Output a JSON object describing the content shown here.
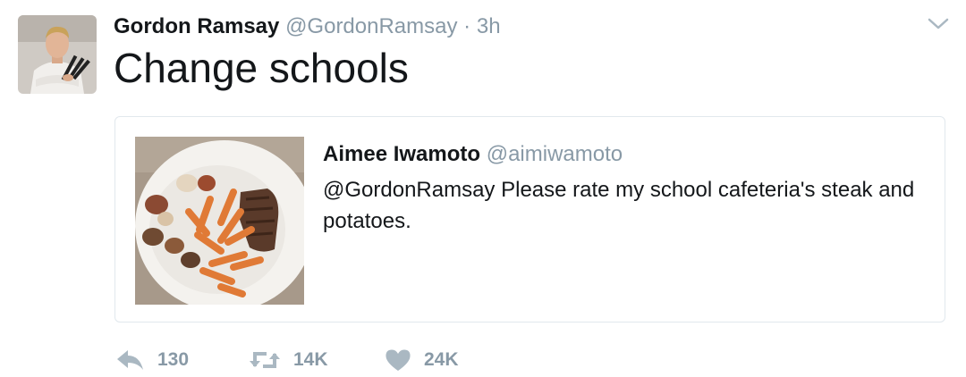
{
  "tweet": {
    "author_name": "Gordon Ramsay",
    "author_handle": "@GordonRamsay",
    "separator": "·",
    "timestamp": "3h",
    "text": "Change schools",
    "menu_icon": "chevron-down-icon"
  },
  "quoted_tweet": {
    "author_name": "Aimee Iwamoto",
    "author_handle": "@aimiwamoto",
    "text": "@GordonRamsay Please rate my school cafeteria's steak and potatoes."
  },
  "actions": {
    "reply": {
      "icon": "reply-icon",
      "count": "130"
    },
    "retweet": {
      "icon": "retweet-icon",
      "count": "14K"
    },
    "like": {
      "icon": "heart-icon",
      "count": "24K"
    }
  },
  "colors": {
    "text": "#14171a",
    "secondary": "#8899a6",
    "border": "#e1e8ed"
  }
}
